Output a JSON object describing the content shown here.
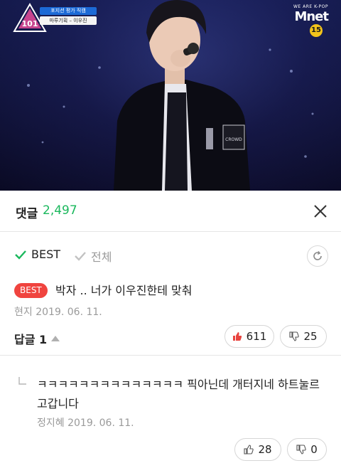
{
  "video": {
    "show_badge_top": "포지션 평가 직캠",
    "show_badge_bottom": "마루기획 – 이우진",
    "logo_text": "101",
    "channel_tagline": "WE ARE K-POP",
    "channel_name": "Mnet",
    "age_rating": "15"
  },
  "header": {
    "title": "댓글",
    "count": "2,497",
    "close_icon": "close-icon"
  },
  "filters": {
    "best_label": "BEST",
    "all_label": "전체",
    "active": "BEST",
    "active_color": "#1bb85d"
  },
  "comment": {
    "badge": "BEST",
    "text": "박자 .. 너가 이우진한테  맞춰",
    "author": "현지",
    "date": "2019. 06. 11.",
    "reply_label": "답글 1",
    "likes": "611",
    "dislikes": "25"
  },
  "reply": {
    "text": "ㅋㅋㅋㅋㅋㅋㅋㅋㅋㅋㅋㅋㅋㅋ 픽아닌데 개터지네 하트눌르고갑니다",
    "author": "정지혜",
    "date": "2019. 06. 11.",
    "likes": "28",
    "dislikes": "0"
  },
  "colors": {
    "accent_green": "#1bb85d",
    "best_red": "#f0443f",
    "like_red": "#e8443f"
  }
}
